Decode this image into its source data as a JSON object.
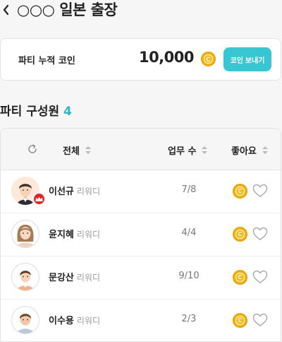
{
  "header": {
    "title": "○○○ 일본 출장"
  },
  "coin_card": {
    "label": "파티 누적 코인",
    "amount": "10,000",
    "coin_symbol": "C",
    "send_button": "코인 보내기"
  },
  "members_section": {
    "title": "파티 구성원",
    "count": "4"
  },
  "table": {
    "columns": [
      "전체",
      "업무 수",
      "좋아요"
    ],
    "rows": [
      {
        "name": "이선규",
        "role": "리워디",
        "tasks": "7/8",
        "coin_symbol": "C",
        "is_leader": true
      },
      {
        "name": "윤지혜",
        "role": "리워디",
        "tasks": "4/4",
        "coin_symbol": "C",
        "is_leader": false
      },
      {
        "name": "문강산",
        "role": "리워디",
        "tasks": "9/10",
        "coin_symbol": "C",
        "is_leader": false
      },
      {
        "name": "이수용",
        "role": "리워디",
        "tasks": "2/3",
        "coin_symbol": "C",
        "is_leader": false
      }
    ]
  },
  "icons": {
    "back": "chevron-left-icon",
    "refresh": "refresh-icon",
    "like": "heart-outline-icon",
    "leader": "crown-icon"
  },
  "colors": {
    "accent": "#38c6d2",
    "count": "#33b7c6",
    "coin": "#f5b914",
    "leader_badge": "#e52222"
  }
}
